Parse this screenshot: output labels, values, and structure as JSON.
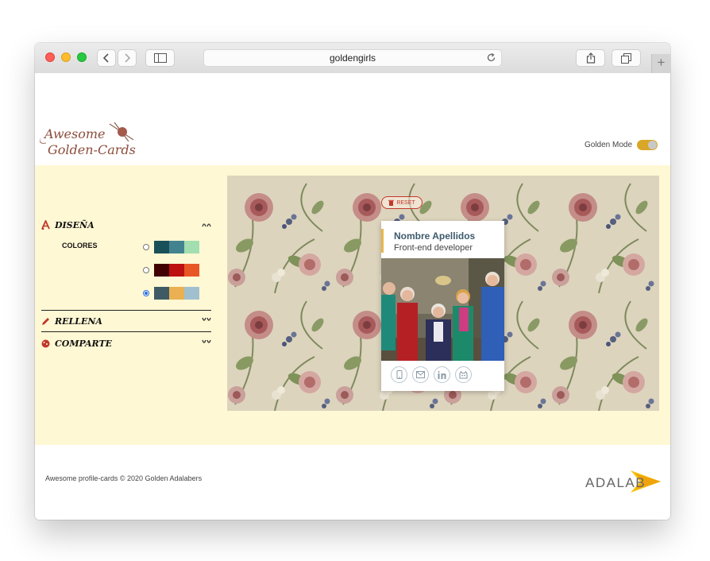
{
  "browser": {
    "address": "goldengirls"
  },
  "header": {
    "logo_text_line1": "Awesome",
    "logo_text_line2": "Golden-Cards",
    "golden_mode_label": "Golden Mode",
    "golden_mode_on": true
  },
  "sidebar": {
    "design": {
      "title": "DISEÑA",
      "colors_label": "COLORES"
    },
    "palettes": [
      {
        "colors": [
          "#1a5159",
          "#438390",
          "#a2deaf"
        ],
        "selected": false
      },
      {
        "colors": [
          "#420101",
          "#bd1010",
          "#e95626"
        ],
        "selected": false
      },
      {
        "colors": [
          "#3e5b65",
          "#eab052",
          "#a0c0cf"
        ],
        "selected": true
      }
    ],
    "fill": {
      "title": "RELLENA"
    },
    "share": {
      "title": "COMPARTE"
    }
  },
  "preview": {
    "reset_label": "RESET",
    "card": {
      "name": "Nombre Apellidos",
      "job": "Front-end developer"
    }
  },
  "footer": {
    "copyright": "Awesome profile-cards © 2020 Golden Adalabers",
    "brand": "ADALAB"
  },
  "colors": {
    "main_background": "#fff8d4",
    "accent_red": "#c0392b",
    "toggle": "#d8a728",
    "card_name": "#3d5a6b"
  }
}
